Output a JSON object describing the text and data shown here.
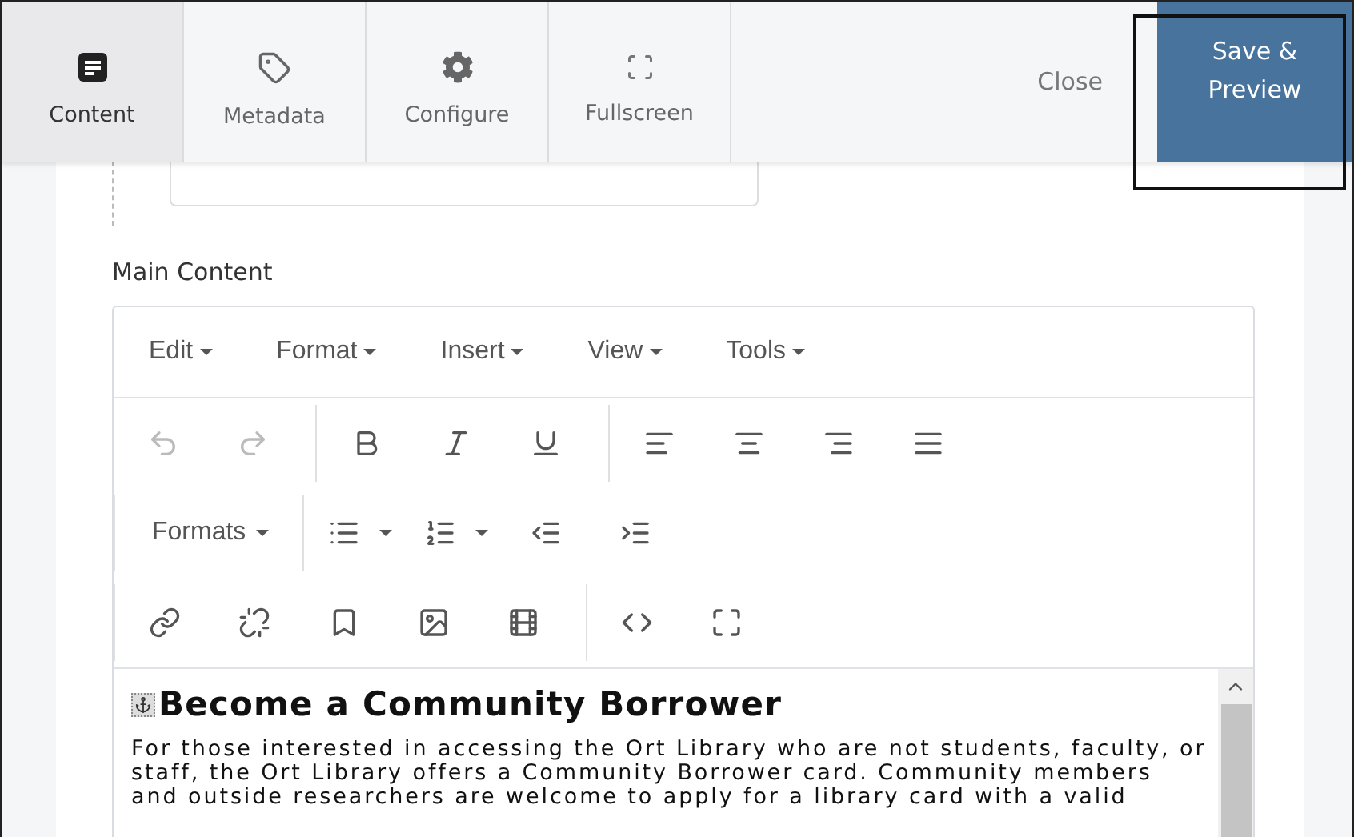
{
  "tabs": [
    {
      "label": "Content",
      "selected": true
    },
    {
      "label": "Metadata",
      "selected": false
    },
    {
      "label": "Configure",
      "selected": false
    },
    {
      "label": "Fullscreen",
      "selected": false
    }
  ],
  "actions": {
    "close": "Close",
    "save": "Save & Preview",
    "save_focused": true
  },
  "field_label": "Main Content",
  "editor": {
    "menus": [
      "Edit",
      "Format",
      "Insert",
      "View",
      "Tools"
    ],
    "toolbar": [
      [
        [
          {
            "kind": "icon",
            "disabled": true
          },
          {
            "kind": "icon",
            "disabled": true
          }
        ],
        [
          {
            "kind": "icon",
            "disabled": false
          },
          {
            "kind": "icon",
            "disabled": false
          },
          {
            "kind": "icon",
            "disabled": false
          }
        ],
        [
          {
            "kind": "icon",
            "disabled": false
          },
          {
            "kind": "icon",
            "disabled": false
          },
          {
            "kind": "icon",
            "disabled": false
          },
          {
            "kind": "icon",
            "disabled": false
          }
        ]
      ],
      [
        [
          {
            "kind": "menu",
            "label": "Formats"
          }
        ],
        [
          {
            "kind": "split",
            "disabled": false
          },
          {
            "kind": "split",
            "disabled": false
          },
          {
            "kind": "icon",
            "disabled": false
          },
          {
            "kind": "icon",
            "disabled": false
          }
        ]
      ],
      [
        [
          {
            "kind": "icon",
            "disabled": false
          },
          {
            "kind": "icon",
            "disabled": false
          },
          {
            "kind": "icon",
            "disabled": false
          },
          {
            "kind": "icon",
            "disabled": false
          },
          {
            "kind": "icon",
            "disabled": false
          }
        ],
        [
          {
            "kind": "icon",
            "disabled": false
          },
          {
            "kind": "icon",
            "disabled": false
          }
        ]
      ]
    ],
    "heading": "Become a Community Borrower",
    "paragraph": "For those interested in accessing the Ort Library who are not students, faculty, or staff, the Ort Library offers a Community Borrower card. Community members and outside researchers are welcome to apply for a library card with a valid"
  }
}
